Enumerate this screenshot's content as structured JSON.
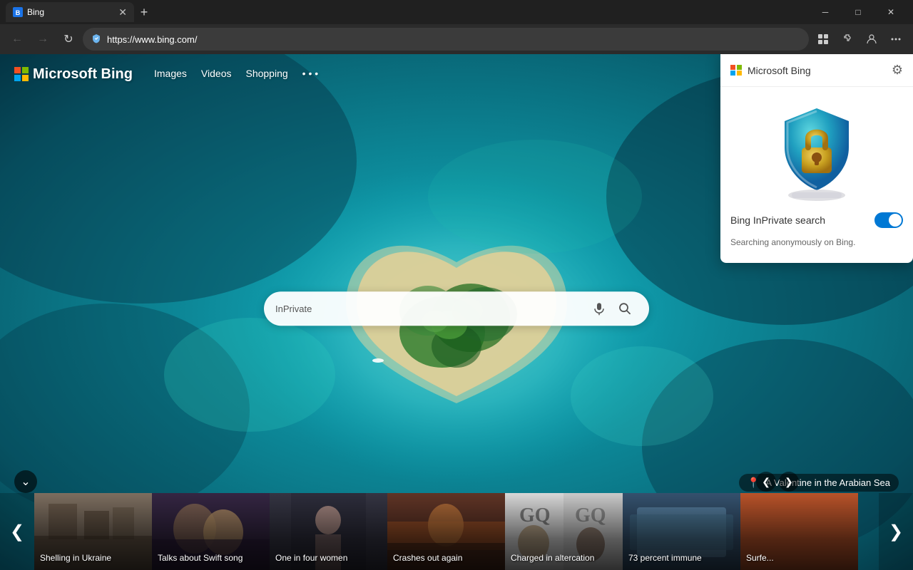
{
  "browser": {
    "tab": {
      "favicon": "🅱",
      "title": "Bing",
      "close_btn": "✕"
    },
    "new_tab_btn": "+",
    "window_controls": {
      "minimize": "─",
      "maximize": "□",
      "close": "✕"
    },
    "nav": {
      "back_btn": "←",
      "forward_btn": "→",
      "refresh_btn": "↻",
      "address": "https://www.bing.com/",
      "extension_btn": "🧩",
      "extensions_btn": "🔧",
      "profile_btn": "👤",
      "menu_btn": "⋯"
    }
  },
  "bing": {
    "logo_text": "Microsoft Bing",
    "nav_items": [
      "Images",
      "Videos",
      "Shopping",
      "•••"
    ],
    "search": {
      "placeholder": "",
      "inprivate_label": "InPrivate",
      "mic_icon": "🎤",
      "search_icon": "🔍"
    },
    "location_label": "A Valentine in the Arabian Sea",
    "collapse_icon": "⌄",
    "carousel": {
      "prev_icon": "❮",
      "next_icon": "❯",
      "items": [
        {
          "title": "Shelling in Ukraine",
          "bg_class": "news-bg-ukraine"
        },
        {
          "title": "Talks about Swift song",
          "bg_class": "news-bg-swift"
        },
        {
          "title": "One in four women",
          "bg_class": "news-bg-women"
        },
        {
          "title": "Crashes out again",
          "bg_class": "news-bg-crashes"
        },
        {
          "title": "Charged in altercation",
          "bg_class": "news-bg-charged"
        },
        {
          "title": "73 percent immune",
          "bg_class": "news-bg-immune"
        },
        {
          "title": "Surfe...",
          "bg_class": "news-bg-surf"
        }
      ]
    }
  },
  "popup": {
    "title": "Microsoft Bing",
    "gear_icon": "⚙",
    "setting_label": "Bing InPrivate search",
    "toggle_state": "on",
    "description": "Searching anonymously on Bing."
  }
}
